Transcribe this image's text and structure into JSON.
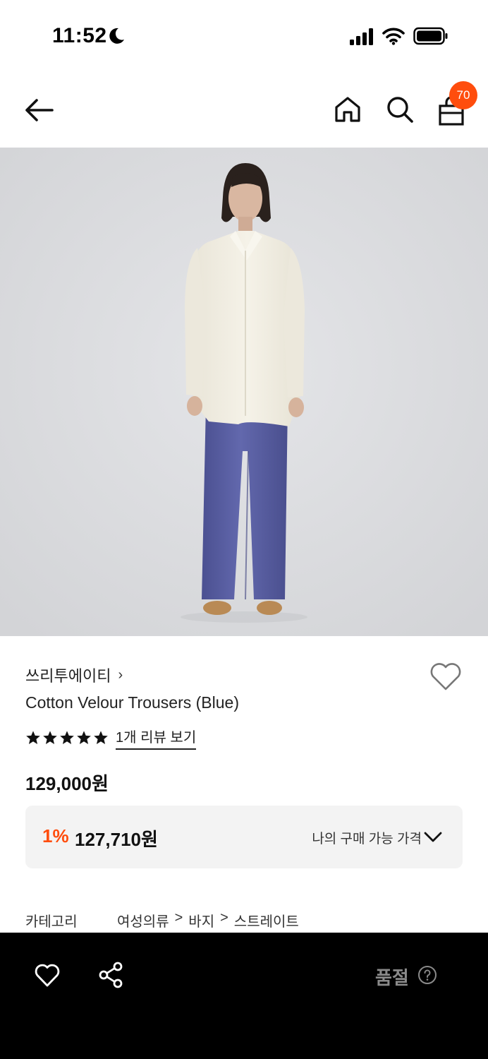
{
  "status_bar": {
    "time": "11:52"
  },
  "header": {
    "cart_count": "70"
  },
  "product": {
    "brand": "쓰리투에이티",
    "brand_chevron": "›",
    "name": "Cotton Velour Trousers (Blue)",
    "rating_stars": 5,
    "review_link": "1개 리뷰 보기",
    "price": "129,000원",
    "discount_rate": "1%",
    "discount_price": "127,710원",
    "my_price_label": "나의 구매 가능 가격",
    "category_label": "카테고리",
    "category_path": [
      "여성의류",
      "바지",
      "스트레이트"
    ]
  },
  "bottom_bar": {
    "soldout_label": "품절"
  },
  "colors": {
    "accent": "#ff4d0d",
    "price_box_bg": "#f3f3f3",
    "bottom_bar_bg": "#000000",
    "trousers": "#5a5fa3",
    "shirt": "#f1eee3"
  },
  "icons": [
    "moon-icon",
    "signal-icon",
    "wifi-icon",
    "battery-icon",
    "back-arrow-icon",
    "home-icon",
    "search-icon",
    "shopping-bag-icon",
    "heart-icon",
    "star-icon",
    "chevron-down-icon",
    "share-icon",
    "help-icon"
  ]
}
